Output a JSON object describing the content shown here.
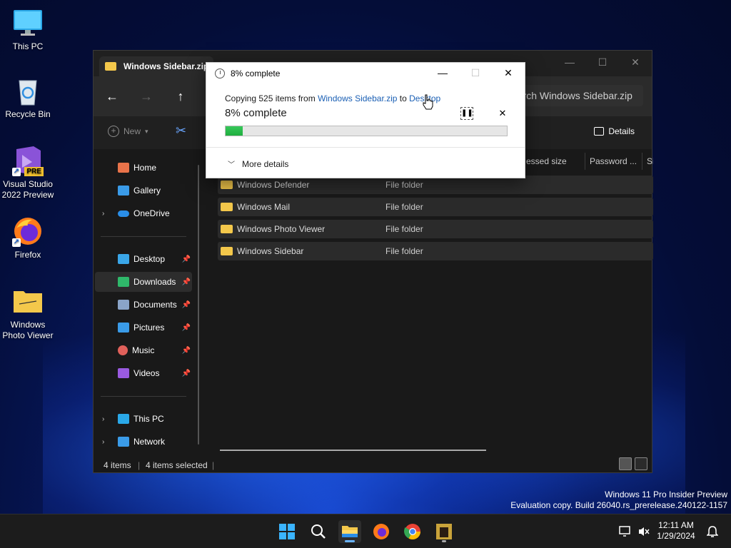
{
  "desktop": {
    "icons": [
      {
        "label": "This PC",
        "icon": "monitor-icon"
      },
      {
        "label": "Recycle Bin",
        "icon": "recycle-bin-icon"
      },
      {
        "label": "Visual Studio 2022 Preview",
        "icon": "visual-studio-icon",
        "badge": "PRE"
      },
      {
        "label": "Firefox",
        "icon": "firefox-icon"
      },
      {
        "label": "Windows Photo Viewer",
        "icon": "photo-viewer-folder-icon"
      }
    ],
    "watermark_line1": "Windows 11 Pro Insider Preview",
    "watermark_line2": "Evaluation copy. Build 26040.rs_prerelease.240122-1157"
  },
  "explorer": {
    "tab_title": "Windows Sidebar.zip",
    "search_placeholder": "earch Windows Sidebar.zip",
    "new_label": "New",
    "details_label": "Details",
    "sidebar": {
      "home": "Home",
      "gallery": "Gallery",
      "onedrive": "OneDrive",
      "desktop": "Desktop",
      "downloads": "Downloads",
      "documents": "Documents",
      "pictures": "Pictures",
      "music": "Music",
      "videos": "Videos",
      "thispc": "This PC",
      "network": "Network"
    },
    "columns": {
      "compressed": "essed size",
      "password": "Password ...",
      "size": "Si"
    },
    "rows": [
      {
        "name": "Windows Defender",
        "type": "File folder"
      },
      {
        "name": "Windows Mail",
        "type": "File folder"
      },
      {
        "name": "Windows Photo Viewer",
        "type": "File folder"
      },
      {
        "name": "Windows Sidebar",
        "type": "File folder"
      }
    ],
    "status": {
      "count": "4 items",
      "selected": "4 items selected"
    }
  },
  "dialog": {
    "title": "8% complete",
    "copy_prefix": "Copying 525 items from ",
    "source": "Windows Sidebar.zip",
    "to": " to ",
    "destination": "Desktop",
    "percent_text": "8% complete",
    "progress": 0.06,
    "more_details": "More details"
  },
  "taskbar": {
    "time": "12:11 AM",
    "date": "1/29/2024"
  },
  "colors": {
    "accent": "#1a5fb4",
    "progress": "#1fae3e",
    "folder": "#f4c84b"
  }
}
